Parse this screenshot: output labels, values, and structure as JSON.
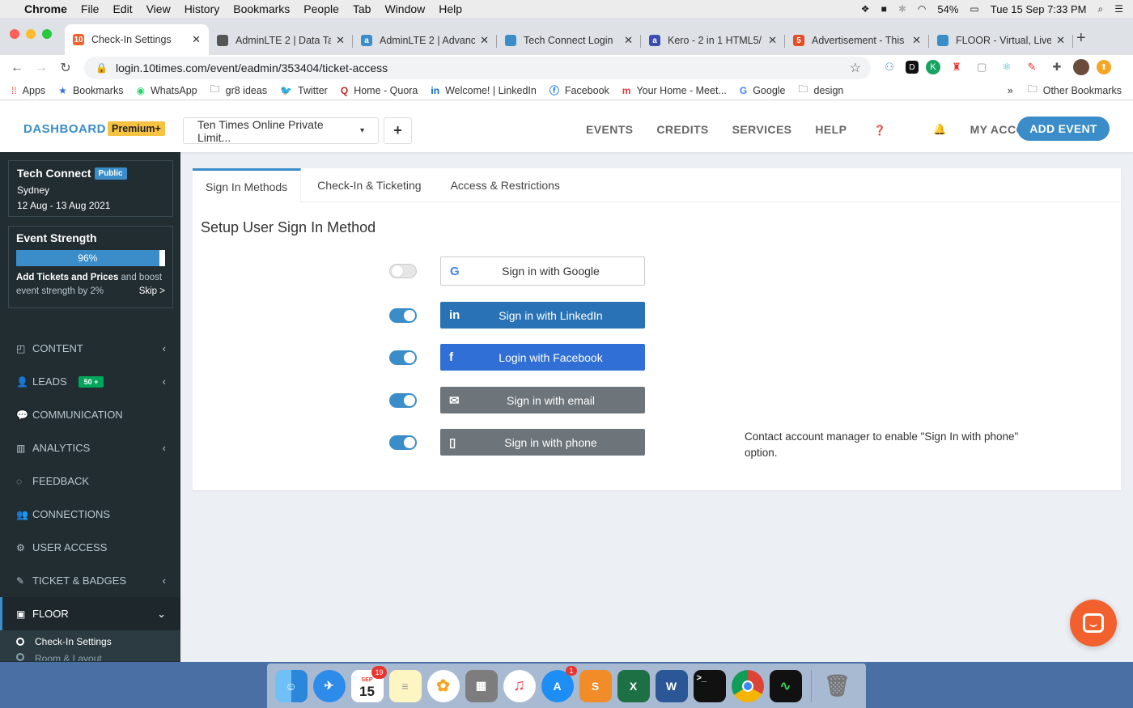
{
  "mac_menu": {
    "app": "Chrome",
    "items": [
      "File",
      "Edit",
      "View",
      "History",
      "Bookmarks",
      "People",
      "Tab",
      "Window",
      "Help"
    ],
    "battery": "54%",
    "clock": "Tue 15 Sep  7:33 PM"
  },
  "browser": {
    "tabs": [
      {
        "label": "Check-In Settings",
        "fav": "10",
        "color": "#f2602e"
      },
      {
        "label": "AdminLTE 2 | Data Ta",
        "fav": "",
        "color": "#555555"
      },
      {
        "label": "AdminLTE 2 | Advanc",
        "fav": "a",
        "color": "#3a8dc8"
      },
      {
        "label": "Tech Connect Login",
        "fav": "",
        "color": "#3a8dc8"
      },
      {
        "label": "Kero - 2 in 1 HTML5/",
        "fav": "a",
        "color": "#3a4db0"
      },
      {
        "label": "Advertisement - This",
        "fav": "5",
        "color": "#e44d26"
      },
      {
        "label": "FLOOR - Virtual, Live",
        "fav": "",
        "color": "#3a8dc8"
      }
    ],
    "url": "login.10times.com/event/eadmin/353404/ticket-access",
    "bookmarks": [
      "Apps",
      "Bookmarks",
      "WhatsApp",
      "gr8 ideas",
      "Twitter",
      "Home - Quora",
      "Welcome! | LinkedIn",
      "Facebook",
      "Your Home - Meet...",
      "Google",
      "design"
    ],
    "bookmarks_overflow": "»",
    "other_bookmarks": "Other Bookmarks"
  },
  "topnav": {
    "logo": "DASHBOARD",
    "premium": "Premium+",
    "company": "Ten Times Online Private Limit...",
    "plus": "+",
    "menu": [
      "EVENTS",
      "CREDITS",
      "SERVICES",
      "HELP",
      "MY ACCOUNT"
    ],
    "add_event": "ADD EVENT"
  },
  "sidebar": {
    "event_name": "Tech Connect",
    "event_badge": "Public",
    "city": "Sydney",
    "dates": "12 Aug - 13 Aug 2021",
    "strength_title": "Event Strength",
    "strength_value": 0.96,
    "strength_label": "96%",
    "tip_bold": "Add Tickets and Prices",
    "tip_rest": " and boost event strength by 2%",
    "skip": "Skip >",
    "menu": [
      {
        "label": "CONTENT",
        "icon": "content-icon",
        "glyph": "◰",
        "chev": "‹"
      },
      {
        "label": "LEADS",
        "icon": "leads-icon",
        "glyph": "👤",
        "chev": "‹",
        "badge": "50 +"
      },
      {
        "label": "COMMUNICATION",
        "icon": "chat-icon",
        "glyph": "💬",
        "chev": ""
      },
      {
        "label": "ANALYTICS",
        "icon": "bar-chart-icon",
        "glyph": "▥",
        "chev": "‹"
      },
      {
        "label": "FEEDBACK",
        "icon": "feedback-icon",
        "glyph": "◌",
        "chev": ""
      },
      {
        "label": "CONNECTIONS",
        "icon": "users-icon",
        "glyph": "👥",
        "chev": ""
      },
      {
        "label": "USER ACCESS",
        "icon": "gear-icon",
        "glyph": "⚙",
        "chev": ""
      },
      {
        "label": "TICKET & BADGES",
        "icon": "ticket-icon",
        "glyph": "✎",
        "chev": "‹"
      }
    ],
    "floor_label": "FLOOR",
    "floor_chev": "⌄",
    "sub_items": [
      "Check-In Settings",
      "Room & Layout"
    ]
  },
  "panel": {
    "tabs": [
      "Sign In Methods",
      "Check-In & Ticketing",
      "Access & Restrictions"
    ],
    "title": "Setup User Sign In Method",
    "methods": [
      {
        "label": "Sign in with Google",
        "enabled": false,
        "icon": "G",
        "style": "google"
      },
      {
        "label": "Sign in with LinkedIn",
        "enabled": true,
        "icon": "in",
        "style": "linkedin"
      },
      {
        "label": "Login with Facebook",
        "enabled": true,
        "icon": "f",
        "style": "facebook"
      },
      {
        "label": "Sign in with email",
        "enabled": true,
        "icon": "✉",
        "style": "email"
      },
      {
        "label": "Sign in with phone",
        "enabled": true,
        "icon": "▯",
        "style": "phone"
      }
    ],
    "phone_note": "Contact account manager to enable \"Sign In with phone\" option."
  },
  "dock": {
    "calendar_day": "15",
    "calendar_month": "SEP",
    "calendar_badge": "19",
    "appstore_badge": "1"
  }
}
